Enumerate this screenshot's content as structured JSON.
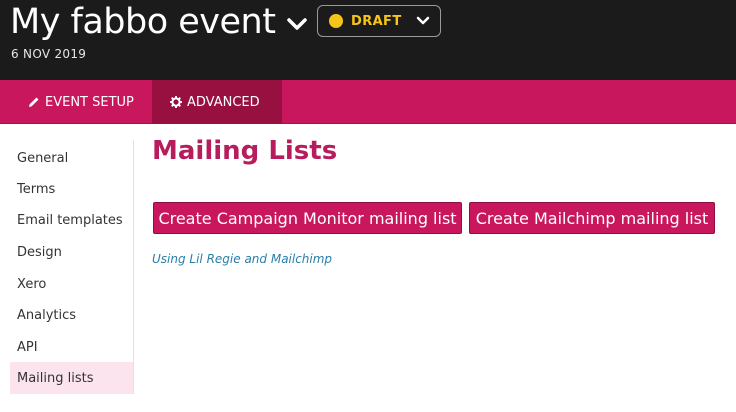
{
  "header": {
    "event_title": "My fabbo event",
    "event_date": "6 NOV 2019",
    "status": {
      "label": "DRAFT",
      "color": "#f5c518"
    }
  },
  "tabs": [
    {
      "label": "EVENT SETUP",
      "icon": "pencil-icon",
      "active": false
    },
    {
      "label": "ADVANCED",
      "icon": "gear-icon",
      "active": true
    }
  ],
  "sidebar": {
    "items": [
      {
        "label": "General"
      },
      {
        "label": "Terms"
      },
      {
        "label": "Email templates"
      },
      {
        "label": "Design"
      },
      {
        "label": "Xero"
      },
      {
        "label": "Analytics"
      },
      {
        "label": "API"
      },
      {
        "label": "Mailing lists",
        "active": true
      }
    ]
  },
  "main": {
    "title": "Mailing Lists",
    "buttons": {
      "campaign_monitor": "Create Campaign Monitor mailing list",
      "mailchimp": "Create Mailchimp mailing list"
    },
    "help_link": "Using Lil Regie and Mailchimp"
  },
  "colors": {
    "header_bg": "#1b1b1b",
    "accent": "#c9175e",
    "active_tab": "#97103f",
    "title": "#b71c5d",
    "link": "#2a7fa8"
  }
}
